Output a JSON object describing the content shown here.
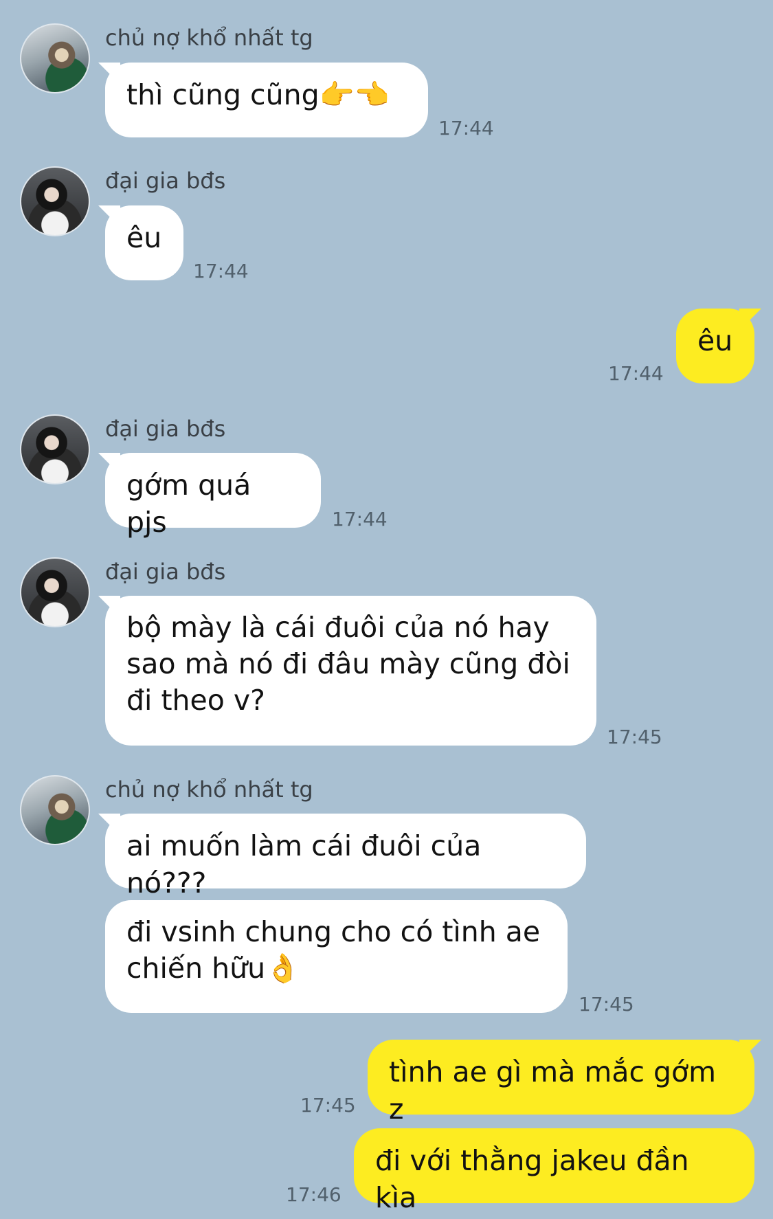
{
  "messages": [
    {
      "sender": "chủ nợ khổ nhất tg",
      "text": "thì cũng cũng👉👈",
      "time": "17:44"
    },
    {
      "sender": "đại gia bđs",
      "text": "êu",
      "time": "17:44"
    },
    {
      "sender": "me",
      "text": "êu",
      "time": "17:44"
    },
    {
      "sender": "đại gia bđs",
      "text": "gớm quá pjs",
      "time": "17:44"
    },
    {
      "sender": "đại gia bđs",
      "text": "bộ mày là cái đuôi của nó hay\nsao mà nó đi đâu mày cũng đòi\nđi theo v?",
      "time": "17:45"
    },
    {
      "sender": "chủ nợ khổ nhất tg",
      "text": "ai muốn làm cái đuôi của nó???",
      "time": ""
    },
    {
      "sender": "chủ nợ khổ nhất tg",
      "text": "đi vsinh chung cho có tình ae\nchiến hữu👌",
      "time": "17:45"
    },
    {
      "sender": "me",
      "text": "tình ae gì mà mắc gớm z",
      "time": "17:45"
    },
    {
      "sender": "me",
      "text": "đi với thằng jakeu đần kìa",
      "time": "17:46"
    }
  ],
  "colors": {
    "background": "#a9c0d2",
    "incoming_bubble": "#ffffff",
    "outgoing_bubble": "#fdec21"
  }
}
